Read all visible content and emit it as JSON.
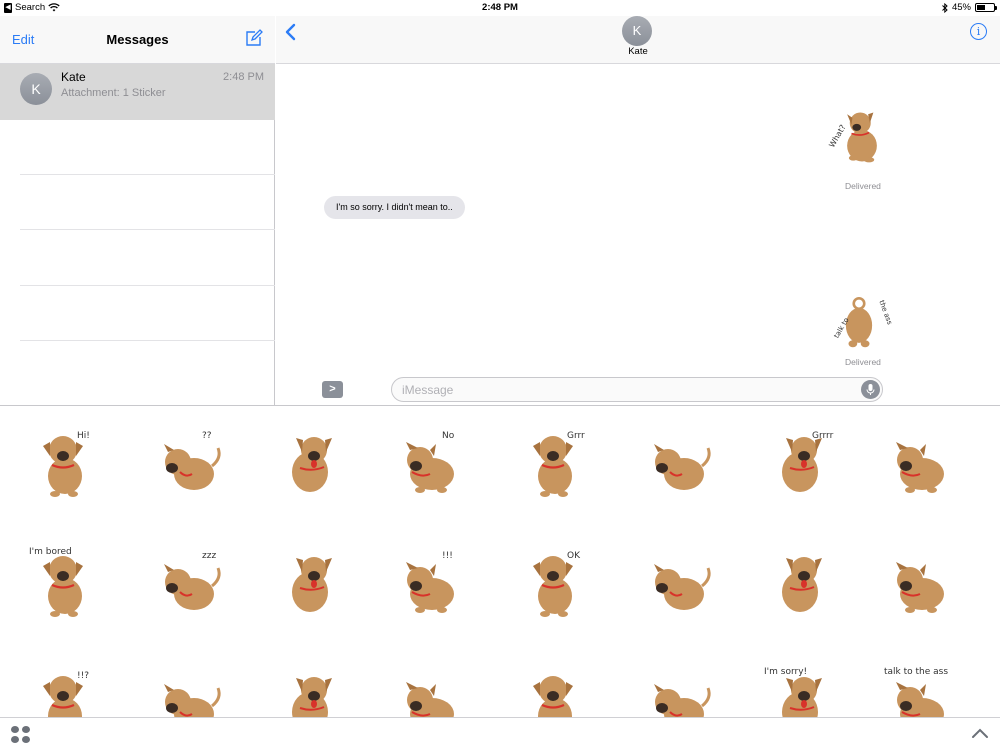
{
  "status_bar": {
    "back_app": "Search",
    "time": "2:48 PM",
    "battery": "45%",
    "battery_level": 0.45
  },
  "sidebar": {
    "edit_label": "Edit",
    "title": "Messages",
    "conversations": [
      {
        "initial": "K",
        "name": "Kate",
        "time": "2:48 PM",
        "preview": "Attachment: 1 Sticker"
      }
    ]
  },
  "chat": {
    "contact_initial": "K",
    "contact_name": "Kate",
    "messages": [
      {
        "from": "me",
        "type": "sticker",
        "sticker": "puppy-what-sticker",
        "text": "What?",
        "status": "Delivered"
      },
      {
        "from": "them",
        "type": "text",
        "text": "I'm so sorry. I didn't mean to.."
      },
      {
        "from": "me",
        "type": "sticker",
        "sticker": "puppy-talk-to-the-ass-sticker",
        "text": "talk to the ass",
        "status": "Delivered"
      }
    ],
    "input_placeholder": "iMessage",
    "apps_button": ">"
  },
  "sticker_drawer": {
    "stickers": [
      {
        "name": "puppy-hi-sticker",
        "caption": "Hi!"
      },
      {
        "name": "puppy-question-sticker",
        "caption": "??"
      },
      {
        "name": "puppy-tail-wag-sticker",
        "caption": ""
      },
      {
        "name": "puppy-no-sticker",
        "caption": "No"
      },
      {
        "name": "puppy-grrr-sticker",
        "caption": "Grrr"
      },
      {
        "name": "puppy-tongue-out-sticker",
        "caption": ""
      },
      {
        "name": "puppy-grrrr-angry-sticker",
        "caption": "Grrrr"
      },
      {
        "name": "puppy-stretch-sticker",
        "caption": ""
      },
      {
        "name": "puppy-im-bored-sticker",
        "caption": "I'm bored"
      },
      {
        "name": "puppy-sleeping-sticker",
        "caption": "zzz"
      },
      {
        "name": "puppy-scratch-sticker",
        "caption": ""
      },
      {
        "name": "puppy-surprised-sticker",
        "caption": "!!!"
      },
      {
        "name": "puppy-ok-sticker",
        "caption": "OK"
      },
      {
        "name": "puppy-rolling-sticker",
        "caption": ""
      },
      {
        "name": "puppy-shake-sticker",
        "caption": ""
      },
      {
        "name": "puppy-sit-sticker",
        "caption": ""
      },
      {
        "name": "puppy-confused-sticker",
        "caption": "!!?"
      },
      {
        "name": "puppy-dreaming-bone-sticker",
        "caption": ""
      },
      {
        "name": "puppy-tongue-sticker",
        "caption": ""
      },
      {
        "name": "puppy-bee-sting-sticker",
        "caption": ""
      },
      {
        "name": "puppy-crying-sticker",
        "caption": ""
      },
      {
        "name": "puppy-kiss-sticker",
        "caption": ""
      },
      {
        "name": "puppy-im-sorry-sticker",
        "caption": "I'm sorry!"
      },
      {
        "name": "puppy-talk-to-the-ass-sticker",
        "caption": "talk to the ass"
      }
    ]
  },
  "colors": {
    "accent": "#2b7cf6",
    "selected_row": "#d8d8d8",
    "bubble_gray": "#e5e5ea",
    "puppy_fur": "#c8955e",
    "puppy_dark": "#3a2c24",
    "collar_red": "#d8322a"
  }
}
